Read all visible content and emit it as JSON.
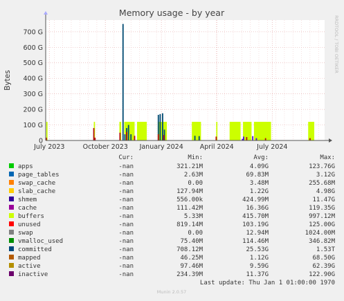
{
  "chart_data": {
    "type": "area",
    "title": "Memory usage - by year",
    "ylabel": "Bytes",
    "xlabel": "",
    "ylim": [
      0,
      775
    ],
    "y_unit": "G",
    "y_ticks": [
      {
        "value": 0,
        "label": "0"
      },
      {
        "value": 100,
        "label": "100 G"
      },
      {
        "value": 200,
        "label": "200 G"
      },
      {
        "value": 300,
        "label": "300 G"
      },
      {
        "value": 400,
        "label": "400 G"
      },
      {
        "value": 500,
        "label": "500 G"
      },
      {
        "value": 600,
        "label": "600 G"
      },
      {
        "value": 700,
        "label": "700 G"
      }
    ],
    "x_range": [
      "2023-06-25",
      "2024-09-25"
    ],
    "x_ticks": [
      {
        "date": "2023-07-01",
        "label": "July 2023"
      },
      {
        "date": "2023-10-01",
        "label": "October 2023"
      },
      {
        "date": "2024-01-01",
        "label": "January 2024"
      },
      {
        "date": "2024-04-01",
        "label": "April 2024"
      },
      {
        "date": "2024-07-01",
        "label": "July 2024"
      }
    ],
    "grid": true,
    "series_estimates": [
      {
        "name": "unused",
        "color": "#ccff00",
        "points": [
          [
            "2023-06-26",
            120
          ],
          [
            "2023-06-28",
            120
          ],
          [
            "2023-09-12",
            120
          ],
          [
            "2023-09-14",
            120
          ],
          [
            "2023-10-24",
            120
          ],
          [
            "2023-10-27",
            120
          ],
          [
            "2023-11-01",
            120
          ],
          [
            "2023-11-18",
            120
          ],
          [
            "2023-11-22",
            120
          ],
          [
            "2023-12-08",
            120
          ],
          [
            "2023-12-26",
            120
          ],
          [
            "2024-01-10",
            120
          ],
          [
            "2024-02-20",
            120
          ],
          [
            "2024-03-06",
            120
          ],
          [
            "2024-03-31",
            120
          ],
          [
            "2024-04-02",
            120
          ],
          [
            "2024-04-22",
            120
          ],
          [
            "2024-05-10",
            120
          ],
          [
            "2024-05-14",
            120
          ],
          [
            "2024-05-28",
            120
          ],
          [
            "2024-06-01",
            120
          ],
          [
            "2024-06-29",
            120
          ],
          [
            "2024-08-29",
            120
          ],
          [
            "2024-09-08",
            120
          ]
        ]
      },
      {
        "name": "committed",
        "color": "#004b73",
        "points": [
          [
            "2023-10-30",
            750
          ],
          [
            "2023-11-02",
            40
          ],
          [
            "2023-11-05",
            80
          ],
          [
            "2023-11-08",
            100
          ],
          [
            "2023-11-12",
            40
          ],
          [
            "2023-12-27",
            165
          ],
          [
            "2023-12-30",
            170
          ],
          [
            "2024-01-03",
            175
          ],
          [
            "2024-01-06",
            70
          ],
          [
            "2024-02-25",
            30
          ],
          [
            "2024-03-03",
            28
          ]
        ]
      },
      {
        "name": "inactive",
        "color": "#b31010",
        "points": [
          [
            "2023-06-26",
            18
          ],
          [
            "2023-09-12",
            80
          ],
          [
            "2023-09-14",
            18
          ],
          [
            "2023-10-25",
            50
          ],
          [
            "2023-11-05",
            55
          ],
          [
            "2023-11-18",
            30
          ],
          [
            "2023-12-27",
            40
          ],
          [
            "2024-01-05",
            35
          ],
          [
            "2024-03-31",
            25
          ],
          [
            "2024-05-20",
            22
          ],
          [
            "2024-06-20",
            15
          ],
          [
            "2024-09-01",
            15
          ]
        ]
      },
      {
        "name": "buffers",
        "color": "#4c0bd9",
        "points": [
          [
            "2024-05-13",
            10
          ],
          [
            "2024-05-15",
            25
          ],
          [
            "2024-05-30",
            28
          ],
          [
            "2024-06-05",
            15
          ]
        ]
      }
    ],
    "side_label": "RRDTOOL / TOBI OETIKER"
  },
  "legend": {
    "headers": {
      "cur": "Cur:",
      "min": "Min:",
      "avg": "Avg:",
      "max": "Max:"
    },
    "rows": [
      {
        "name": "apps",
        "color": "#00cc00",
        "cur": "-nan",
        "min": "321.21M",
        "avg": "4.09G",
        "max": "123.76G"
      },
      {
        "name": "page_tables",
        "color": "#0066b3",
        "cur": "-nan",
        "min": "2.63M",
        "avg": "69.83M",
        "max": "3.12G"
      },
      {
        "name": "swap_cache",
        "color": "#ff8000",
        "cur": "-nan",
        "min": "0.00",
        "avg": "3.48M",
        "max": "255.68M"
      },
      {
        "name": "slab_cache",
        "color": "#ffcc00",
        "cur": "-nan",
        "min": "127.94M",
        "avg": "1.22G",
        "max": "4.98G"
      },
      {
        "name": "shmem",
        "color": "#330099",
        "cur": "-nan",
        "min": "556.00k",
        "avg": "424.99M",
        "max": "11.47G"
      },
      {
        "name": "cache",
        "color": "#990099",
        "cur": "-nan",
        "min": "111.42M",
        "avg": "16.36G",
        "max": "119.35G"
      },
      {
        "name": "buffers",
        "color": "#ccff00",
        "cur": "-nan",
        "min": "5.33M",
        "avg": "415.70M",
        "max": "997.12M"
      },
      {
        "name": "unused",
        "color": "#ff0000",
        "cur": "-nan",
        "min": "819.14M",
        "avg": "103.19G",
        "max": "125.00G"
      },
      {
        "name": "swap",
        "color": "#808080",
        "cur": "-nan",
        "min": "0.00",
        "avg": "12.94M",
        "max": "1024.00M"
      },
      {
        "name": "vmalloc_used",
        "color": "#008f00",
        "cur": "-nan",
        "min": "75.40M",
        "avg": "114.46M",
        "max": "346.82M"
      },
      {
        "name": "committed",
        "color": "#00487d",
        "cur": "-nan",
        "min": "708.12M",
        "avg": "25.53G",
        "max": "1.53T"
      },
      {
        "name": "mapped",
        "color": "#b35a00",
        "cur": "-nan",
        "min": "46.25M",
        "avg": "1.12G",
        "max": "68.50G"
      },
      {
        "name": "active",
        "color": "#b38f00",
        "cur": "-nan",
        "min": "97.46M",
        "avg": "9.59G",
        "max": "62.39G"
      },
      {
        "name": "inactive",
        "color": "#6b006b",
        "cur": "-nan",
        "min": "234.39M",
        "avg": "11.37G",
        "max": "122.90G"
      }
    ]
  },
  "footer": {
    "last_update": "Last update:  Thu Jan  1 01:00:00 1970",
    "version": "Munin 2.0.57"
  }
}
